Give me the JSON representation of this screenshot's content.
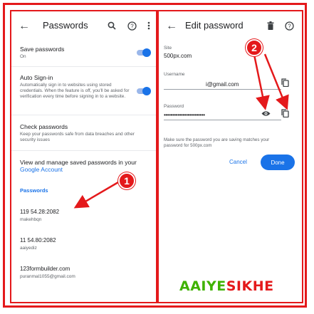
{
  "left": {
    "title": "Passwords",
    "back_icon": "arrow-left-icon",
    "settings": [
      {
        "title": "Save passwords",
        "subtitle": "On",
        "enabled": true
      },
      {
        "title": "Auto Sign-in",
        "subtitle": "Automatically sign in to websites using stored credentials. When the feature is off, you'll be asked for verification every time before signing in to a website.",
        "enabled": true
      },
      {
        "title": "Check passwords",
        "subtitle": "Keep your passwords safe from data breaches and other security issues"
      }
    ],
    "manage_text": "View and manage saved passwords in your",
    "manage_link": "Google Account",
    "section_header": "Passwords",
    "entries": [
      {
        "site": "119 54.28:2082",
        "user": "makehbqn"
      },
      {
        "site": "11 54.80:2082",
        "user": "aaiyediz"
      },
      {
        "site": "123formbuilder.com",
        "user": "puranmal1055@gmail.com"
      }
    ]
  },
  "right": {
    "title": "Edit password",
    "site_label": "Site",
    "site_value": "500px.com",
    "username_label": "Username",
    "username_value": "i@gmail.com",
    "password_label": "Password",
    "password_value": "••••••••••••••••••••••••",
    "note": "Make sure the password you are saving matches your password for 500px.com",
    "cancel_label": "Cancel",
    "done_label": "Done"
  },
  "badges": {
    "one": "1",
    "two": "2"
  },
  "watermark": {
    "part1": "AAIYE",
    "part2": "SIKHE"
  },
  "colors": {
    "accent": "#1a73e8",
    "annotation": "#e4191b",
    "watermark_green": "#3fb200"
  }
}
